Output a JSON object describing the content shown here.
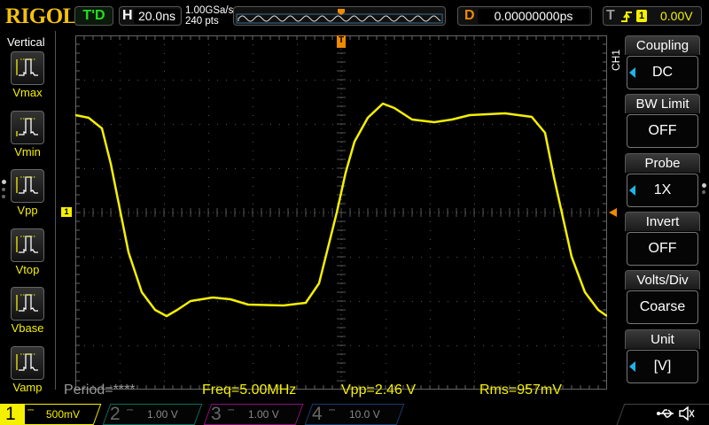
{
  "header": {
    "logo": "RIGOL",
    "run_status": "T'D",
    "timebase_label": "H",
    "timebase": "20.0ns",
    "sample_rate": "1.00GSa/s",
    "memory_depth": "240 pts",
    "delay_label": "D",
    "delay": "0.00000000ps",
    "trigger_label": "T",
    "trigger_edge_icon": "rising-edge-icon",
    "trigger_source": "1",
    "trigger_level": "0.00V"
  },
  "left_menu": {
    "title": "Vertical",
    "items": [
      {
        "label": "Vmax"
      },
      {
        "label": "Vmin"
      },
      {
        "label": "Vpp"
      },
      {
        "label": "Vtop"
      },
      {
        "label": "Vbase"
      },
      {
        "label": "Vamp"
      }
    ]
  },
  "right_menu": {
    "channel": "CH1",
    "items": [
      {
        "title": "Coupling",
        "value": "DC",
        "arrow": true
      },
      {
        "title": "BW Limit",
        "value": "OFF",
        "arrow": false
      },
      {
        "title": "Probe",
        "value": "1X",
        "arrow": true
      },
      {
        "title": "Invert",
        "value": "OFF",
        "arrow": false
      },
      {
        "title": "Volts/Div",
        "value": "Coarse",
        "arrow": false
      },
      {
        "title": "Unit",
        "value": "[V]",
        "arrow": true
      }
    ]
  },
  "measurements": {
    "period": "Period=****",
    "freq": "Freq=5.00MHz",
    "vpp": "Vpp=2.46 V",
    "rms": "Rms=957mV"
  },
  "channels": [
    {
      "num": "1",
      "scale": "500mV",
      "color": "#f5f000",
      "active": true
    },
    {
      "num": "2",
      "scale": "1.00 V",
      "color": "#0e8a7a",
      "active": false
    },
    {
      "num": "3",
      "scale": "1.00 V",
      "color": "#b0169a",
      "active": false
    },
    {
      "num": "4",
      "scale": "10.0 V",
      "color": "#1a4f90",
      "active": false
    }
  ],
  "markers": {
    "trigger_pos": "T",
    "ch1_marker": "1"
  },
  "status_icons": [
    "usb-icon",
    "speaker-muted-icon"
  ],
  "colors": {
    "ch1": "#f5f000",
    "trigger": "#f08a00",
    "accent": "#1eb4e8"
  }
}
